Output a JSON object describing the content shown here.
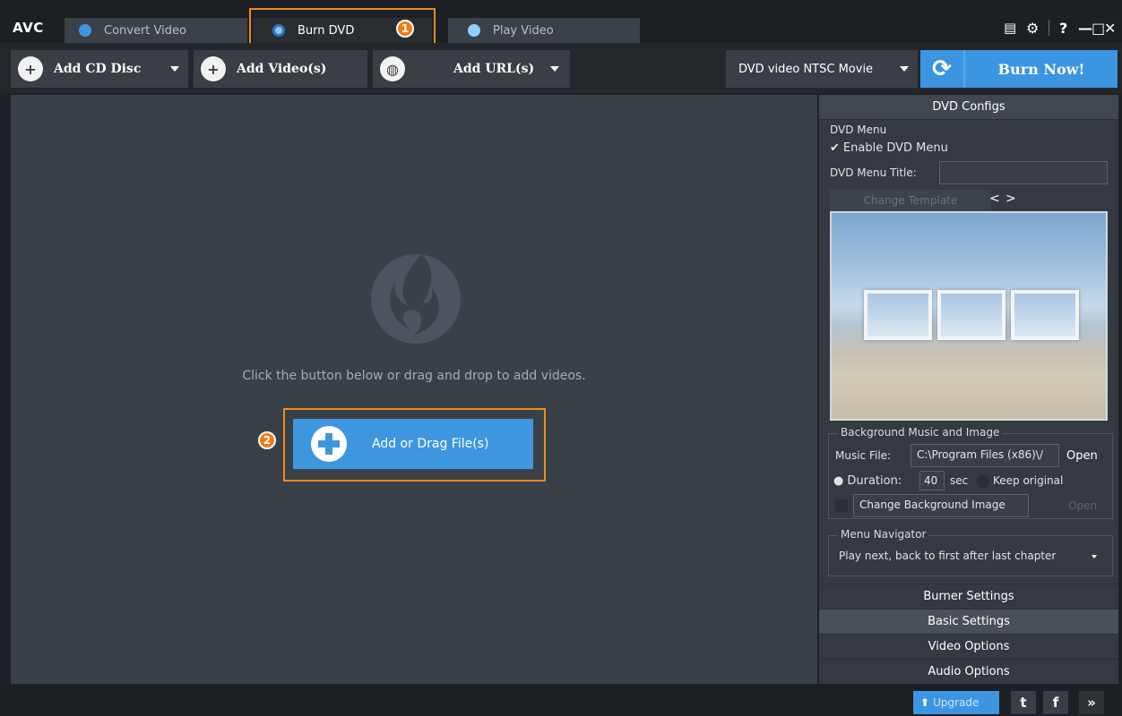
{
  "app": {
    "logo": "AVC"
  },
  "tabs": [
    {
      "label": "Convert Video",
      "active": false
    },
    {
      "label": "Burn DVD",
      "active": true
    },
    {
      "label": "Play Video",
      "active": false
    }
  ],
  "annotations": {
    "badge1": "1",
    "badge2": "2"
  },
  "window_controls": {
    "help": "?",
    "minimize": "—",
    "maximize": "□",
    "close": "✕"
  },
  "toolbar": {
    "add_cd_disc": "Add CD Disc",
    "add_videos": "Add Video(s)",
    "add_url": "Add URL(s)",
    "profile": "DVD video NTSC Movie",
    "burn_now": "Burn Now!"
  },
  "main": {
    "hint": "Click the button below or drag and drop to add videos.",
    "add_file": "Add or Drag File(s)"
  },
  "panel": {
    "title": "DVD Configs",
    "dvd_menu": {
      "legend": "DVD Menu",
      "enable_label": "Enable DVD Menu",
      "enable_checked": true,
      "title_label": "DVD Menu Title:",
      "title_value": "",
      "change_template": "Change Template",
      "prev": "<",
      "next": ">"
    },
    "bg_music": {
      "legend": "Background Music and Image",
      "music_label": "Music File:",
      "music_value": "C:\\Program Files (x86)\\/",
      "open": "Open",
      "duration_label": "Duration:",
      "duration_value": "40",
      "sec": "sec",
      "keep_original": "Keep original",
      "change_bg": "Change Background Image",
      "open_bg": "Open"
    },
    "navigator": {
      "legend": "Menu Navigator",
      "value": "Play next, back to first after last chapter"
    },
    "sections": [
      "Burner Settings",
      "Basic Settings",
      "Video Options",
      "Audio Options"
    ]
  },
  "status": {
    "upgrade": "Upgrade",
    "twitter": "t",
    "facebook": "f",
    "more": "»"
  },
  "colors": {
    "accent": "#3b95e0",
    "highlight": "#f08a1c",
    "badge": "#f07c16"
  }
}
